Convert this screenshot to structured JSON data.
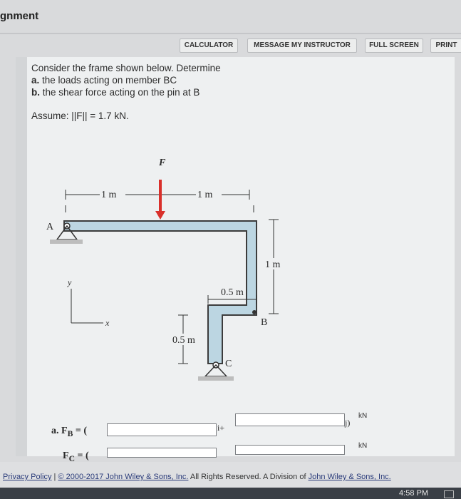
{
  "page_title_fragment": "gnment",
  "toolbar": {
    "calculator": "CALCULATOR",
    "message": "MESSAGE MY INSTRUCTOR",
    "fullscreen": "FULL SCREEN",
    "print": "PRINT"
  },
  "question": {
    "intro": "Consider the frame shown below. Determine",
    "a_prefix": "a.",
    "a_text": " the loads acting on member BC",
    "b_prefix": "b.",
    "b_text": " the shear force acting on the pin at B",
    "assume_prefix": "Assume: ||F|| = 1.7 kN."
  },
  "figure": {
    "force_label": "F",
    "dim_top_left": "1 m",
    "dim_top_right": "1 m",
    "dim_right": "1 m",
    "dim_mid": "0.5 m",
    "dim_low": "0.5 m",
    "point_a": "A",
    "point_b": "B",
    "point_c": "C",
    "axis_y": "y",
    "axis_x": "x"
  },
  "answers": {
    "a_label": "a. F",
    "a_sub": "B",
    "a_eq": " = (",
    "i_plus": "i+",
    "j_close": "j)",
    "unit": "kN",
    "c_label": "F",
    "c_sub": "C",
    "c_eq": " = ("
  },
  "footer": {
    "privacy": "Privacy Policy",
    "sep": " | ",
    "copyright_link": "© 2000-2017 John Wiley & Sons, Inc.",
    "rights": " All Rights Reserved. A Division of ",
    "company_link": "John Wiley & Sons, Inc."
  },
  "status": {
    "clock": "4:58 PM"
  },
  "colors": {
    "member_fill": "#bcd6e2",
    "member_stroke": "#3c3c3c",
    "force_arrow": "#d9302b",
    "panel_bg": "#eef0f1"
  }
}
